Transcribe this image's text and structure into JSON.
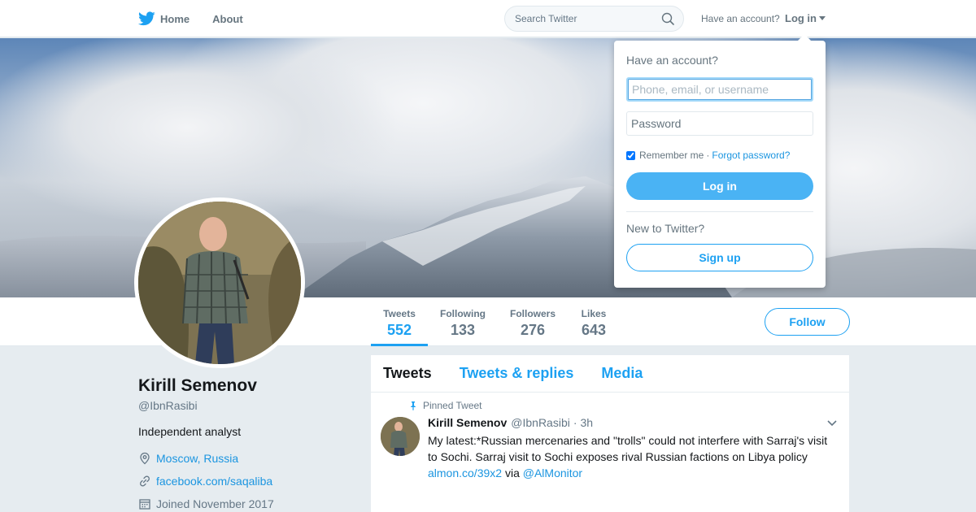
{
  "nav": {
    "home_label": "Home",
    "about_label": "About",
    "search_placeholder": "Search Twitter",
    "account_prompt": "Have an account?",
    "login_label": "Log in",
    "brand_color": "#1da1f2"
  },
  "profile": {
    "name": "Kirill Semenov",
    "handle": "@IbnRasibi",
    "bio": "Independent analyst",
    "location": "Moscow, Russia",
    "website": "facebook.com/saqaliba",
    "joined": "Joined November 2017"
  },
  "stats": {
    "tweets": {
      "label": "Tweets",
      "value": "552"
    },
    "following": {
      "label": "Following",
      "value": "133"
    },
    "followers": {
      "label": "Followers",
      "value": "276"
    },
    "likes": {
      "label": "Likes",
      "value": "643"
    }
  },
  "follow_label": "Follow",
  "timeline": {
    "tabs": [
      "Tweets",
      "Tweets & replies",
      "Media"
    ],
    "tweet": {
      "pinned_label": "Pinned Tweet",
      "author": "Kirill Semenov",
      "handle": "@IbnRasibi",
      "separator": "·",
      "time": "3h",
      "text": "My latest:*Russian mercenaries and \"trolls\" could not interfere with Sarraj's visit to Sochi. Sarraj visit to Sochi exposes rival Russian factions on Libya policy",
      "link": "almon.co/39x2",
      "via": "via",
      "mention": "@AlMonitor"
    }
  },
  "login_dropdown": {
    "title": "Have an account?",
    "username_placeholder": "Phone, email, or username",
    "password_placeholder": "Password",
    "remember_label": "Remember me",
    "dot": "·",
    "forgot_label": "Forgot password?",
    "login_button": "Log in",
    "new_prompt": "New to Twitter?",
    "signup_button": "Sign up"
  }
}
